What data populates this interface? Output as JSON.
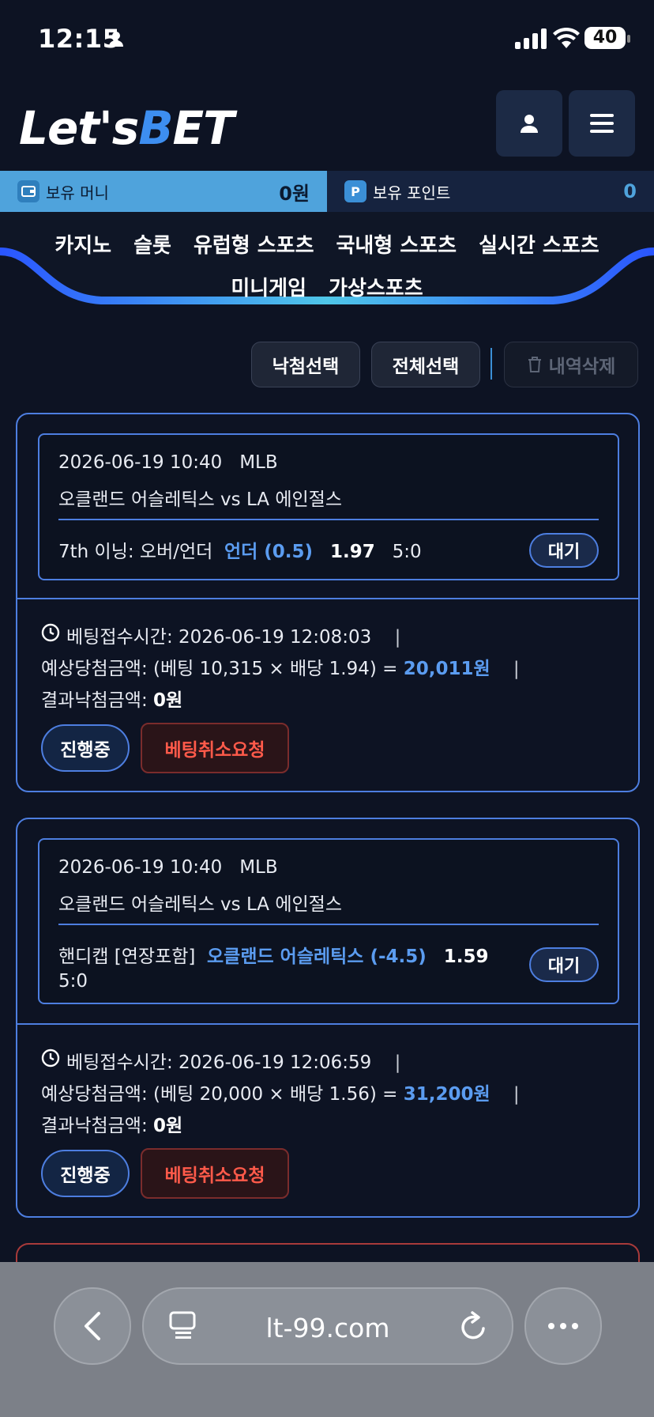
{
  "status_bar": {
    "time": "12:15",
    "battery": "40"
  },
  "header": {
    "logo_part1": "Let's",
    "logo_part2": "B",
    "logo_part3": "ET"
  },
  "balance": {
    "money_label": "보유 머니",
    "money_value": "0원",
    "points_label": "보유 포인트",
    "points_value": "0",
    "points_icon": "P"
  },
  "nav": {
    "row1": [
      "카지노",
      "슬롯",
      "유럽형 스포츠",
      "국내형 스포츠",
      "실시간 스포츠"
    ],
    "row2": [
      "미니게임",
      "가상스포츠"
    ]
  },
  "actions": {
    "select_win": "낙첨선택",
    "select_all": "전체선택",
    "delete": "내역삭제"
  },
  "bets": [
    {
      "datetime": "2026-06-19 10:40",
      "league": "MLB",
      "match": "오클랜드 어슬레틱스 vs LA 에인절스",
      "market": "7th 이닝: 오버/언더",
      "pick": "언더 (0.5)",
      "odds": "1.97",
      "score": "5:0",
      "state": "대기",
      "time_label": "베팅접수시간:",
      "time_value": "2026-06-19 12:08:03",
      "expected_label": "예상당첨금액:",
      "expected_formula": "(베팅 10,315 × 배당 1.94) =",
      "expected_value": "20,011원",
      "result_label": "결과낙첨금액:",
      "result_value": "0원",
      "progress": "진행중",
      "cancel": "베팅취소요청"
    },
    {
      "datetime": "2026-06-19 10:40",
      "league": "MLB",
      "match": "오클랜드 어슬레틱스 vs LA 에인절스",
      "market": "핸디캡 [연장포함]",
      "pick": "오클랜드 어슬레틱스 (-4.5)",
      "odds": "1.59",
      "score": "5:0",
      "state": "대기",
      "time_label": "베팅접수시간:",
      "time_value": "2026-06-19 12:06:59",
      "expected_label": "예상당첨금액:",
      "expected_formula": "(베팅 20,000 × 배당 1.56) =",
      "expected_value": "31,200원",
      "result_label": "결과낙첨금액:",
      "result_value": "0원",
      "progress": "진행중",
      "cancel": "베팅취소요청"
    }
  ],
  "separator_char": "|",
  "browser": {
    "url": "lt-99.com"
  },
  "colors": {
    "accent": "#4d7ee0",
    "link": "#5b9cf0",
    "danger": "#ff5a4a",
    "balance_bg": "#4fa3dc"
  }
}
